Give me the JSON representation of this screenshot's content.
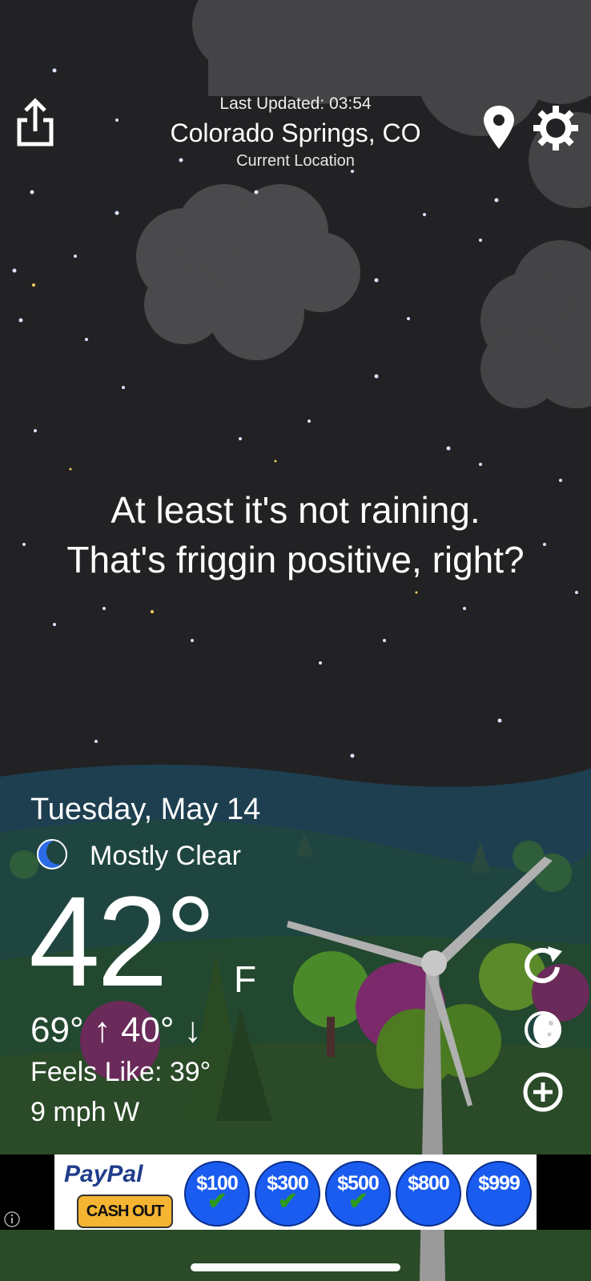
{
  "header": {
    "last_updated": "Last Updated: 03:54",
    "city": "Colorado Springs, CO",
    "location_label": "Current Location"
  },
  "quote": {
    "line1": "At least it's not raining.",
    "line2": "That's friggin positive, right?"
  },
  "weather": {
    "date": "Tuesday, May 14",
    "condition": "Mostly Clear",
    "condition_icon": "crescent-moon-icon",
    "temperature": "42°",
    "unit": "F",
    "hi_lo": "69° ↑ 40° ↓",
    "feels_like": "Feels Like: 39°",
    "wind": "9 mph W"
  },
  "toolbar": {
    "share_icon": "share-icon",
    "location_icon": "map-pin-icon",
    "settings_icon": "gear-icon",
    "refresh_icon": "refresh-icon",
    "moon_icon": "moon-phase-icon",
    "add_icon": "plus-circle-icon"
  },
  "ad": {
    "brand": "PayPal",
    "cta": "CASH OUT",
    "amounts": [
      "$100",
      "$300",
      "$500",
      "$800",
      "$999"
    ],
    "info_icon": "info-icon"
  },
  "colors": {
    "sky": "#222224",
    "cloud": "#4a4a4a",
    "hill_far": "#1e3f50",
    "hill_mid": "#1f4a3f",
    "ground": "#2d4a2d",
    "moon_blue": "#2b6be6",
    "coin_blue": "#1a5cf0",
    "cashout_yellow": "#f5b431",
    "paypal_navy": "#1f3d8a"
  }
}
